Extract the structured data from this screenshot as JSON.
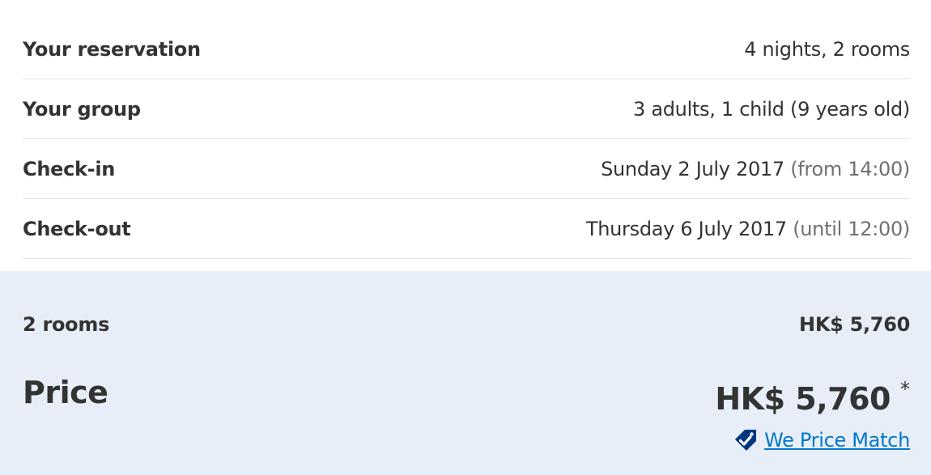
{
  "reservation": {
    "rows": [
      {
        "label": "Your reservation",
        "value": "4 nights, 2 rooms",
        "note": ""
      },
      {
        "label": "Your group",
        "value": "3 adults, 1 child (9 years old)",
        "note": ""
      },
      {
        "label": "Check-in",
        "value": "Sunday 2 July 2017",
        "note": "(from 14:00)"
      },
      {
        "label": "Check-out",
        "value": "Thursday 6 July 2017",
        "note": "(until 12:00)"
      }
    ]
  },
  "pricing": {
    "rooms_label": "2 rooms",
    "rooms_amount": "HK$ 5,760",
    "price_label": "Price",
    "total_amount": "HK$ 5,760",
    "total_asterisk": "*",
    "price_match_icon": "price-tag-check-icon",
    "price_match_label": "We Price Match"
  },
  "colors": {
    "panel_background": "#e8eef8",
    "link": "#0077cc",
    "badge": "#003580"
  }
}
